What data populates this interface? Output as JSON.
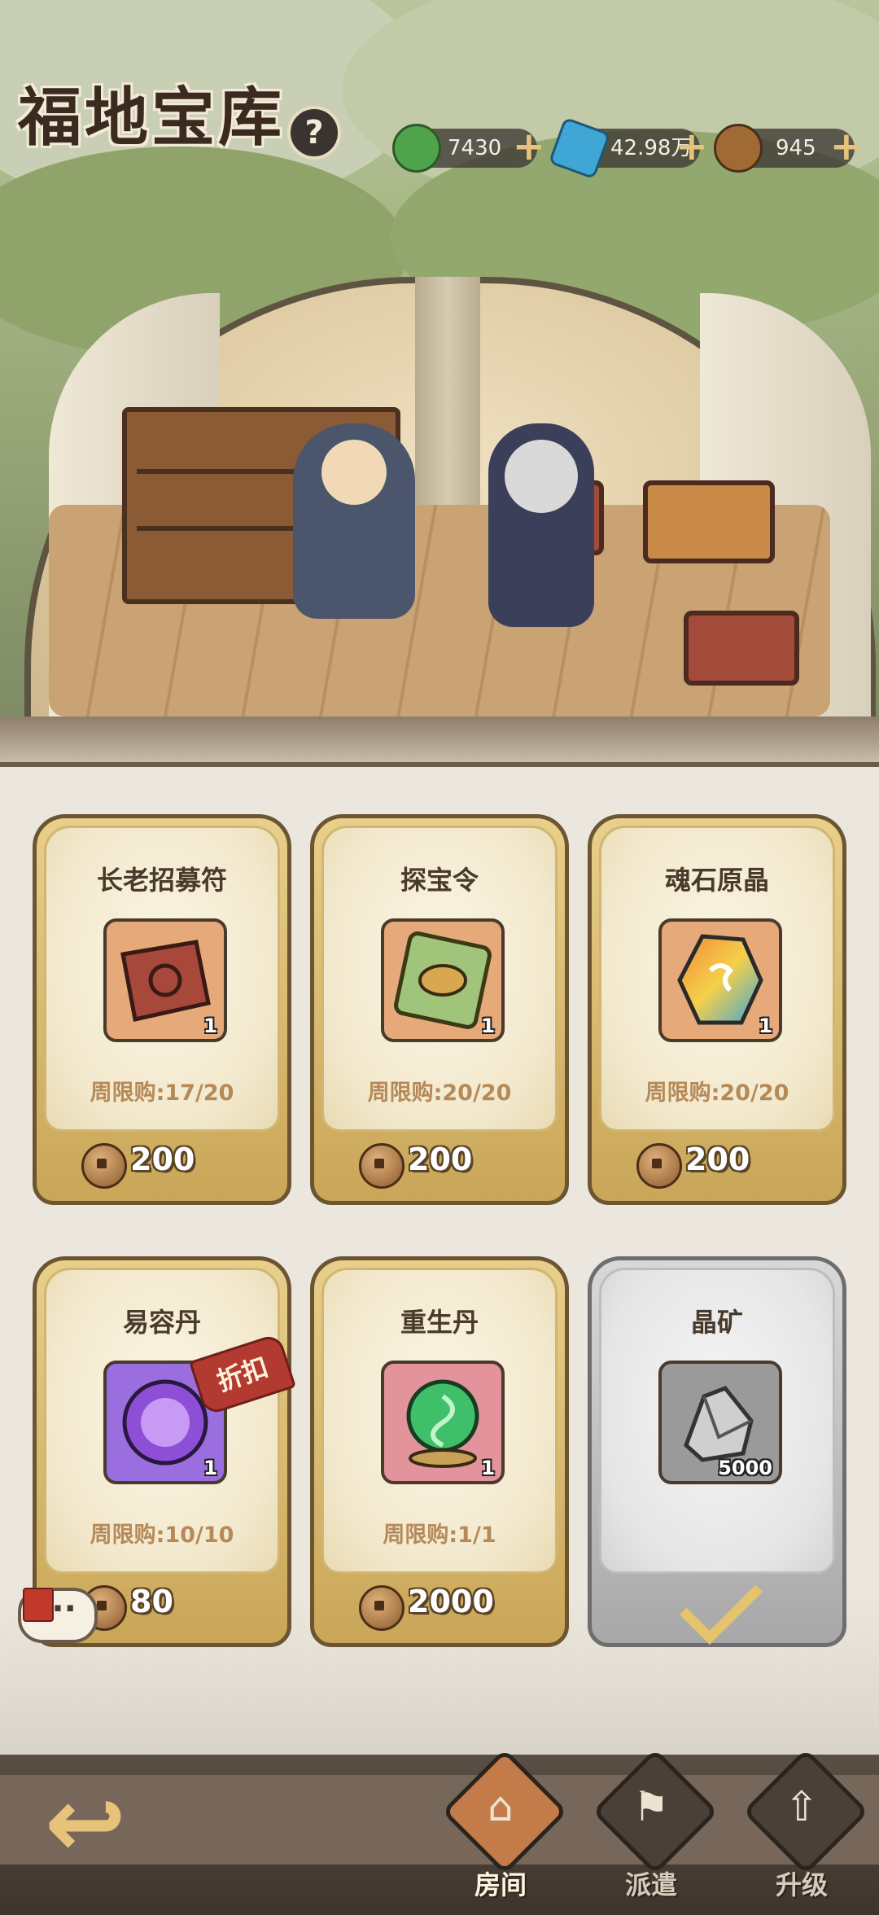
{
  "header": {
    "title": "福地宝库",
    "help_icon": "question-icon"
  },
  "resources": [
    {
      "icon": "jade-currency-icon",
      "value": "7430",
      "color": "#4fa34a"
    },
    {
      "icon": "crystal-currency-icon",
      "value": "42.98万",
      "color": "#3fa6d6"
    },
    {
      "icon": "copper-coin-icon",
      "value": "945",
      "color": "#a06a35"
    }
  ],
  "shop": {
    "items": [
      {
        "name": "长老招募符",
        "qty": "1",
        "limit": "周限购:17/20",
        "price": "200",
        "icon": "recruit-talisman-icon",
        "color": "#e6a97a"
      },
      {
        "name": "探宝令",
        "qty": "1",
        "limit": "周限购:20/20",
        "price": "200",
        "icon": "treasure-token-icon",
        "color": "#e6a97a"
      },
      {
        "name": "魂石原晶",
        "qty": "1",
        "limit": "周限购:20/20",
        "price": "200",
        "icon": "soul-crystal-icon",
        "color": "#e6a97a"
      },
      {
        "name": "易容丹",
        "qty": "1",
        "limit": "周限购:10/10",
        "price": "80",
        "icon": "disguise-pill-icon",
        "color": "#9b6ee0",
        "badge": "折扣"
      },
      {
        "name": "重生丹",
        "qty": "1",
        "limit": "周限购:1/1",
        "price": "2000",
        "icon": "rebirth-pill-icon",
        "color": "#e3939b"
      },
      {
        "name": "晶矿",
        "qty": "5000",
        "icon": "crystal-ore-icon",
        "color": "#9a9a9a",
        "sold_out": true
      }
    ]
  },
  "bottom_nav": {
    "back_icon": "back-arrow-icon",
    "tabs": [
      {
        "label": "房间",
        "icon": "house-icon",
        "active": true
      },
      {
        "label": "派遣",
        "icon": "flag-icon",
        "active": false
      },
      {
        "label": "升级",
        "icon": "upgrade-icon",
        "active": false
      }
    ]
  }
}
